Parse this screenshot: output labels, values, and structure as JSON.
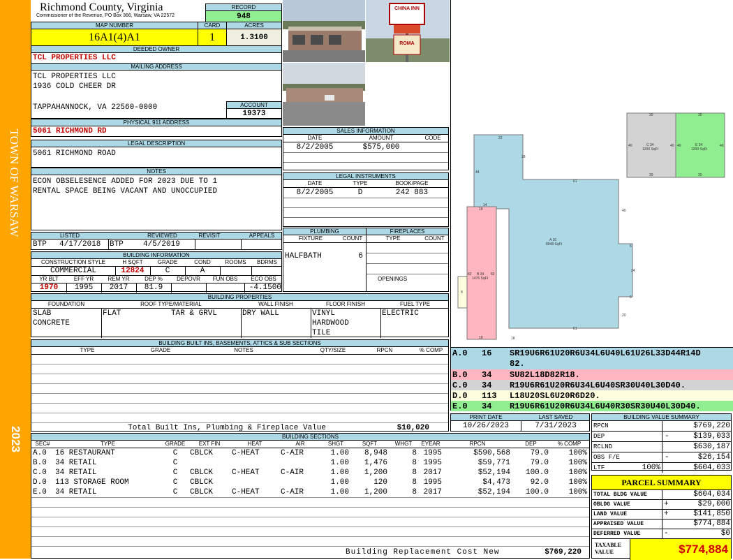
{
  "side_banner": {
    "town": "TOWN OF WARSAW",
    "year": "2023"
  },
  "header": {
    "county": "Richmond County, Virginia",
    "commissioner": "Commissioner of the Revenue, PO Box 366, Warsaw, VA 22572",
    "record_label": "RECORD",
    "record": "948",
    "map_number_label": "MAP NUMBER",
    "map_number": "16A1(4)A1",
    "card_label": "CARD",
    "card": "1",
    "acres_label": "ACRES",
    "acres": "1.3100"
  },
  "owner": {
    "deeded_owner_label": "DEEDED OWNER",
    "deeded_owner": "TCL PROPERTIES LLC",
    "mailing_label": "MAILING ADDRESS",
    "mailing": [
      "TCL PROPERTIES LLC",
      "1936 COLD CHEER DR",
      "",
      "TAPPAHANNOCK, VA 22560-0000"
    ],
    "account_label": "ACCOUNT",
    "account": "19373",
    "physical_label": "PHYSICAL 911 ADDRESS",
    "physical": "5061 RICHMOND RD",
    "legal_label": "LEGAL DESCRIPTION",
    "legal": "5061 RICHMOND ROAD",
    "notes_label": "NOTES",
    "notes": [
      "ECON OBSELESENCE ADDED FOR 2023 DUE TO 1",
      "RENTAL SPACE BEING VACANT AND UNOCCUPIED"
    ]
  },
  "photos": {
    "sign1": "CHINA INN",
    "sign2": "ROMA"
  },
  "sales": {
    "title": "SALES INFORMATION",
    "cols": [
      "DATE",
      "AMOUNT",
      "CODE"
    ],
    "rows": [
      {
        "date": "8/2/2005",
        "amount": "$575,000",
        "code": ""
      }
    ]
  },
  "legal_instruments": {
    "title": "LEGAL INSTRUMENTS",
    "cols": [
      "DATE",
      "TYPE",
      "BOOK/PAGE"
    ],
    "rows": [
      {
        "date": "8/2/2005",
        "type": "D",
        "book": "242 883"
      }
    ]
  },
  "listing": {
    "labels": [
      "LISTED",
      "REVIEWED",
      "REVISIT",
      "APPEALS"
    ],
    "listed_by": "BTP",
    "listed": "4/17/2018",
    "reviewed_by": "BTP",
    "reviewed": "4/5/2019",
    "revisit": "",
    "appeals": ""
  },
  "building_info": {
    "title": "BUILDING INFORMATION",
    "cols": [
      "CONSTRUCTION STYLE",
      "H SQFT",
      "GRADE",
      "COND",
      "ROOMS",
      "BDRMS"
    ],
    "style": "COMMERCIAL",
    "hsqft": "12824",
    "grade": "C",
    "cond": "A",
    "rooms": "",
    "bdrms": "",
    "cols2": [
      "YR BLT",
      "EFF YR",
      "REM YR",
      "DEP %",
      "DEPOVR",
      "FUN OBS",
      "ECO OBS"
    ],
    "yr_blt": "1970",
    "eff_yr": "1995",
    "rem_yr": "2017",
    "dep": "81.9",
    "depovr": "",
    "fun_obs": "",
    "eco_obs": "-4.1500"
  },
  "plumbing": {
    "title": "PLUMBING",
    "cols": [
      "FIXTURE",
      "COUNT"
    ],
    "fixture": "HALFBATH",
    "count": "6"
  },
  "fireplaces": {
    "title": "FIREPLACES",
    "cols": [
      "TYPE",
      "COUNT"
    ],
    "openings_label": "OPENINGS"
  },
  "building_props": {
    "title": "BUILDING PROPERTIES",
    "cols": [
      "FOUNDATION",
      "ROOF TYPE/MATERIAL",
      "WALL FINISH",
      "FLOOR FINISH",
      "FUEL TYPE"
    ],
    "foundation": [
      "SLAB",
      "CONCRETE"
    ],
    "roof_type": "FLAT",
    "roof_material": "TAR & GRVL",
    "wall": "DRY WALL",
    "floor": [
      "VINYL",
      "HARDWOOD",
      "TILE"
    ],
    "fuel": "ELECTRIC"
  },
  "built_ins": {
    "title": "BUILDING BUILT INS, BASEMENTS, ATTICS & SUB SECTIONS",
    "cols": [
      "TYPE",
      "GRADE",
      "NOTES",
      "QTY/SIZE",
      "RPCN",
      "% COMP"
    ],
    "total_label": "Total Built Ins, Plumbing & Fireplace Value",
    "total": "$10,020"
  },
  "sketch": {
    "sections": [
      {
        "label": "A.0",
        "area": "8948 SqFt",
        "sides": [
          "22",
          "28",
          "61",
          "40",
          "6",
          "34",
          "6",
          "20",
          "61",
          "18",
          "14",
          "44"
        ]
      },
      {
        "label": "B.0",
        "area": "1476 SqFt",
        "sides": [
          "18",
          "82",
          "82",
          "18"
        ]
      },
      {
        "label": "C.0",
        "area": "1200 SqFt",
        "sides": [
          "30",
          "40",
          "30",
          "40"
        ]
      },
      {
        "label": "D.0",
        "area": "",
        "sides": [
          "8"
        ]
      },
      {
        "label": "E.0",
        "area": "1200 SqFt",
        "sides": [
          "30",
          "40",
          "30",
          "40"
        ]
      }
    ],
    "legend": [
      {
        "sec": "A.0",
        "code": "16",
        "path": "SR19U6R61U20R6U34L6U40L61U26L33D44R14D",
        "path2": "82.",
        "color": "#add8e6"
      },
      {
        "sec": "B.0",
        "code": "34",
        "path": "SU82L18D82R18.",
        "color": "#ffb6c1"
      },
      {
        "sec": "C.0",
        "code": "34",
        "path": "R19U6R61U20R6U34L6U40SR30U40L30D40.",
        "color": "#d3d3d3"
      },
      {
        "sec": "D.0",
        "code": "113",
        "path": "L18U20SL6U20R6D20.",
        "color": "#ffffe0"
      },
      {
        "sec": "E.0",
        "code": "34",
        "path": "R19U6R61U20R6U34L6U40R30SR30U40L30D40.",
        "color": "#90ee90"
      }
    ]
  },
  "print_info": {
    "print_label": "PRINT DATE",
    "print_date": "10/26/2023",
    "saved_label": "LAST SAVED",
    "saved": "7/31/2023"
  },
  "value_summary": {
    "title": "BUILDING VALUE SUMMARY",
    "rows": [
      {
        "label": "RPCN",
        "sign": "",
        "value": "$769,220"
      },
      {
        "label": "DEP",
        "sign": "-",
        "value": "$139,033"
      },
      {
        "label": "RCLND",
        "sign": "",
        "value": "$630,187"
      },
      {
        "label": "OBS F/E",
        "sign": "-",
        "value": "$26,154"
      },
      {
        "label": "LTF",
        "pct": "100%",
        "sign": "",
        "value": "$604,033"
      }
    ]
  },
  "parcel_summary": {
    "title": "PARCEL SUMMARY",
    "rows": [
      {
        "label": "TOTAL BLDG VALUE",
        "sign": "",
        "value": "$604,034"
      },
      {
        "label": "OBLDG VALUE",
        "sign": "+",
        "value": "$29,000"
      },
      {
        "label": "LAND VALUE",
        "sign": "+",
        "value": "$141,850"
      },
      {
        "label": "APPRAISED VALUE",
        "sign": "",
        "value": "$774,884"
      },
      {
        "label": "DEFERRED VALUE",
        "sign": "-",
        "value": "$0"
      }
    ],
    "taxable_label": "TAXABLE VALUE",
    "taxable": "$774,884"
  },
  "sections": {
    "title": "BUILDING SECTIONS",
    "cols": [
      "SEC#",
      "TYPE",
      "GRADE",
      "EXT FIN",
      "HEAT",
      "AIR",
      "SHGT",
      "SQFT",
      "WHGT",
      "EYEAR",
      "RPCN",
      "DEP",
      "% COMP"
    ],
    "rows": [
      [
        "A.0",
        "16 RESTAURANT",
        "C",
        "CBLCK",
        "C-HEAT",
        "C-AIR",
        "1.00",
        "8,948",
        "8",
        "1995",
        "$590,568",
        "79.0",
        "100%"
      ],
      [
        "B.0",
        "34 RETAIL",
        "C",
        "",
        "",
        "",
        "1.00",
        "1,476",
        "8",
        "1995",
        "$59,771",
        "79.0",
        "100%"
      ],
      [
        "C.0",
        "34 RETAIL",
        "C",
        "CBLCK",
        "C-HEAT",
        "C-AIR",
        "1.00",
        "1,200",
        "8",
        "2017",
        "$52,194",
        "100.0",
        "100%"
      ],
      [
        "D.0",
        "113 STORAGE ROOM",
        "C",
        "CBLCK",
        "",
        "",
        "1.00",
        "120",
        "8",
        "1995",
        "$4,473",
        "92.0",
        "100%"
      ],
      [
        "E.0",
        "34 RETAIL",
        "C",
        "CBLCK",
        "C-HEAT",
        "C-AIR",
        "1.00",
        "1,200",
        "8",
        "2017",
        "$52,194",
        "100.0",
        "100%"
      ]
    ],
    "replacement_label": "Building Replacement Cost New",
    "replacement": "$769,220"
  }
}
